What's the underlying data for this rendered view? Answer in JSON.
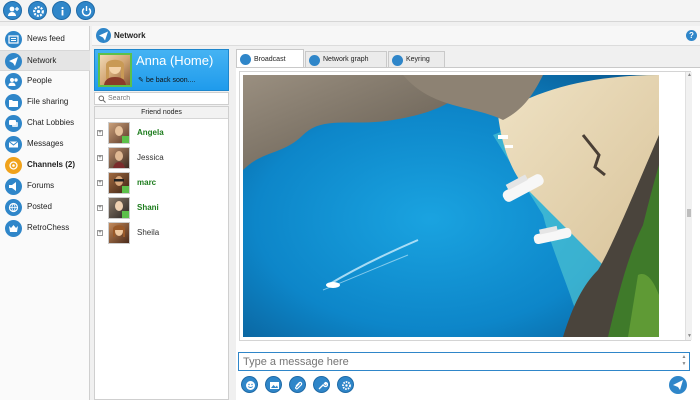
{
  "toolbar": {
    "icons": [
      "add-friend-icon",
      "settings-icon",
      "info-icon",
      "power-icon"
    ]
  },
  "sidebar": {
    "items": [
      {
        "label": "News feed",
        "icon": "news-feed-icon"
      },
      {
        "label": "Network",
        "icon": "network-icon",
        "active": true
      },
      {
        "label": "People",
        "icon": "people-icon"
      },
      {
        "label": "File sharing",
        "icon": "file-sharing-icon"
      },
      {
        "label": "Chat Lobbies",
        "icon": "chat-lobbies-icon"
      },
      {
        "label": "Messages",
        "icon": "messages-icon"
      },
      {
        "label": "Channels (2)",
        "icon": "channels-icon",
        "highlight": true
      },
      {
        "label": "Forums",
        "icon": "forums-icon"
      },
      {
        "label": "Posted",
        "icon": "posted-icon"
      },
      {
        "label": "RetroChess",
        "icon": "retrochess-icon"
      }
    ]
  },
  "network": {
    "title": "Network",
    "help_icon": "help-icon",
    "help_label": "?"
  },
  "profile": {
    "name": "Anna (Home)",
    "status": "be back soon...."
  },
  "search": {
    "placeholder": "Search"
  },
  "friends": {
    "header": "Friend nodes",
    "expander_symbol": "+",
    "items": [
      {
        "name": "Angela",
        "online": true
      },
      {
        "name": "Jessica",
        "online": false
      },
      {
        "name": "marc",
        "online": true
      },
      {
        "name": "Shani",
        "online": true
      },
      {
        "name": "Sheila",
        "online": false
      }
    ]
  },
  "tabs": [
    {
      "label": "Broadcast",
      "active": true
    },
    {
      "label": "Network graph",
      "active": false
    },
    {
      "label": "Keyring",
      "active": false
    }
  ],
  "composer": {
    "placeholder": "Type a message here",
    "buttons": [
      "emoji-icon",
      "image-icon",
      "attach-icon",
      "tools-icon",
      "settings-icon"
    ],
    "send_icon": "send-icon"
  },
  "colors": {
    "accent": "#2f86c9",
    "online": "#1e7d1e",
    "profile_bg": "#1f9bec",
    "highlight": "#f0a21b"
  }
}
